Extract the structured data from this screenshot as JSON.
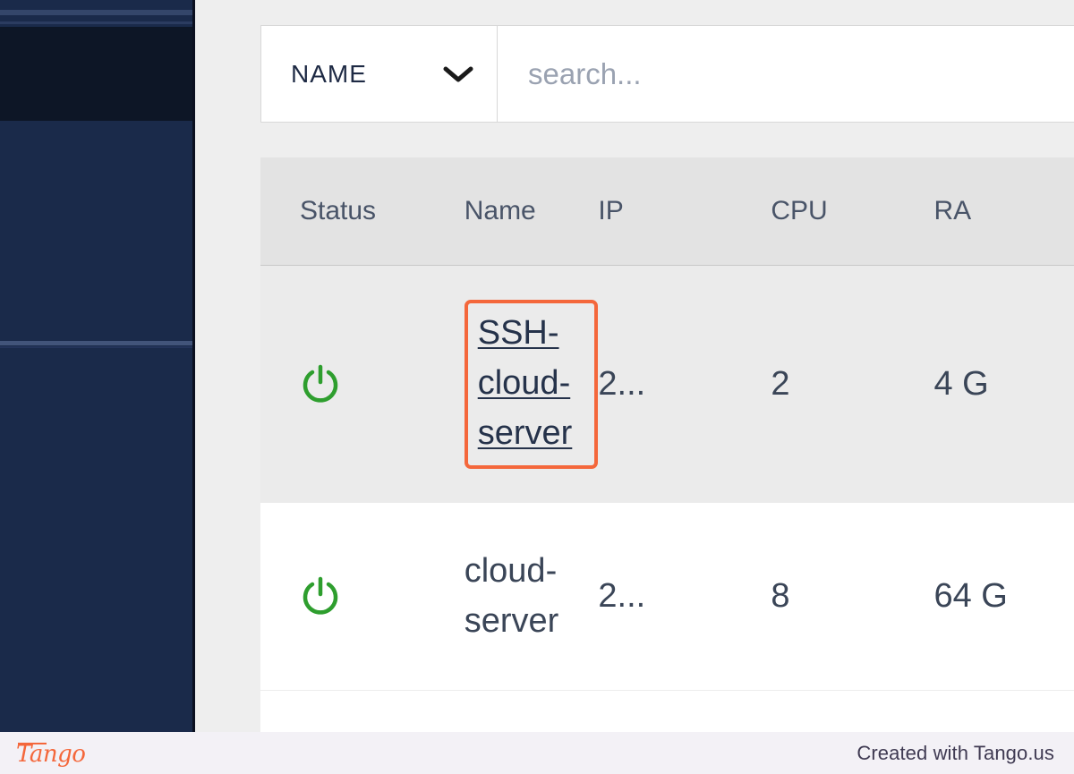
{
  "filter_bar": {
    "sort_field_label": "NAME",
    "sort_chevron_icon": "chevron-down-icon",
    "search_placeholder": "search...",
    "search_value": ""
  },
  "table": {
    "columns": [
      "Status",
      "Name",
      "IP",
      "CPU",
      "RA"
    ],
    "rows": [
      {
        "status_icon": "power-icon",
        "status_color": "#2e9e2e",
        "name": "SSH-cloud-server",
        "name_is_link": true,
        "highlighted": true,
        "ip": "2...",
        "cpu": "2",
        "ram": "4 G"
      },
      {
        "status_icon": "power-icon",
        "status_color": "#2e9e2e",
        "name": "cloud-server",
        "name_is_link": false,
        "highlighted": false,
        "ip": "2...",
        "cpu": "8",
        "ram": "64 G"
      }
    ]
  },
  "footer": {
    "logo_text": "Tango",
    "note": "Created with Tango.us"
  },
  "colors": {
    "accent_orange": "#f4673b",
    "sidebar_navy": "#1a2a4a",
    "sidebar_dark": "#0d1626",
    "status_green": "#2e9e2e",
    "content_bg": "#eeeeee",
    "footer_bg": "#f3f1f6"
  }
}
